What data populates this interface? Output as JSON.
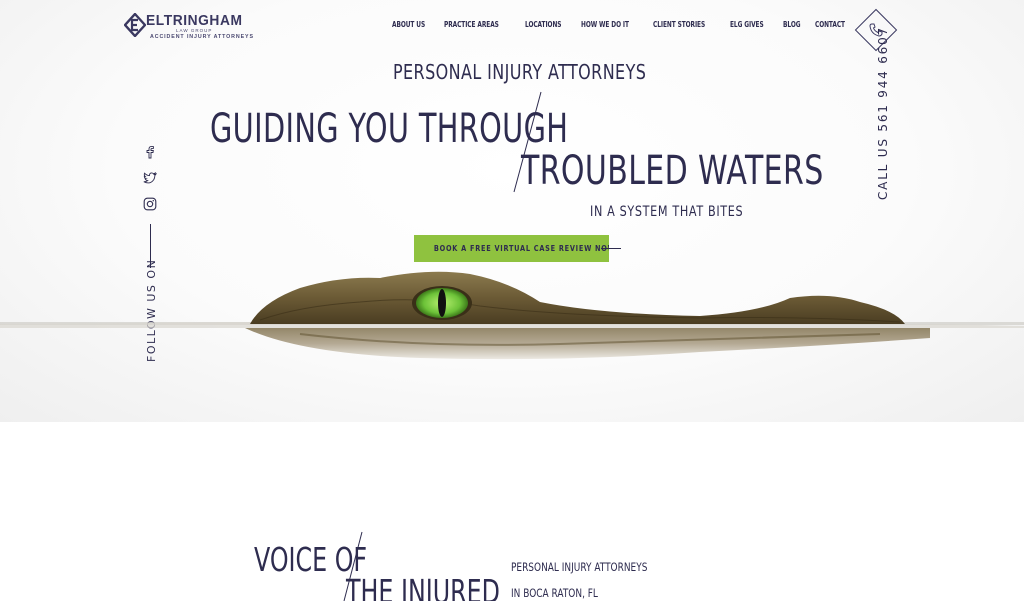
{
  "brand": {
    "name": "ELTRINGHAM",
    "sub": "LAW GROUP",
    "tagline": "ACCIDENT INJURY ATTORNEYS",
    "logo_icon": "elg-monogram-icon"
  },
  "nav": {
    "items": [
      {
        "label": "ABOUT US"
      },
      {
        "label": "PRACTICE AREAS"
      },
      {
        "label": "LOCATIONS"
      },
      {
        "label": "HOW WE DO IT"
      },
      {
        "label": "CLIENT STORIES"
      },
      {
        "label": "ELG GIVES"
      },
      {
        "label": "BLOG"
      },
      {
        "label": "CONTACT"
      }
    ]
  },
  "phone": {
    "icon": "phone-icon",
    "label": "CALL US 561 944 6607"
  },
  "social": {
    "icons": [
      "facebook-icon",
      "twitter-icon",
      "instagram-icon"
    ],
    "follow_label": "FOLLOW US ON"
  },
  "hero": {
    "kicker": "PERSONAL INJURY ATTORNEYS",
    "headline_line1": "GUIDING YOU THROUGH",
    "headline_line2": "TROUBLED WATERS",
    "subline": "IN A SYSTEM THAT BITES",
    "cta_label": "BOOK A FREE VIRTUAL CASE REVIEW NOW",
    "image": "alligator-in-water-image"
  },
  "voice": {
    "line1": "VOICE OF",
    "line2": "THE INJURED",
    "side1": "PERSONAL INJURY ATTORNEYS",
    "side2": "IN BOCA RATON, FL"
  },
  "colors": {
    "navy": "#2e2c4f",
    "accent_green": "#8fc23f",
    "croc_eye": "#7ec84a"
  }
}
